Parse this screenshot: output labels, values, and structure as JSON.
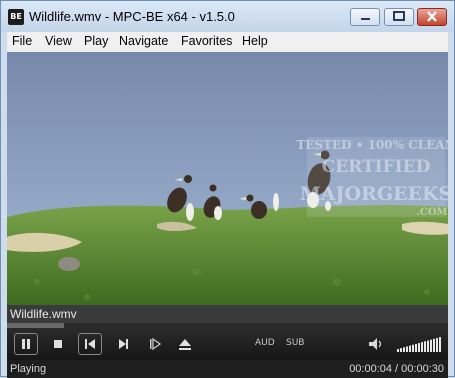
{
  "window": {
    "title": "Wildlife.wmv - MPC-BE x64 - v1.5.0",
    "app_icon_text": "BE"
  },
  "menu": {
    "items": [
      "File",
      "View",
      "Play",
      "Navigate",
      "Favorites",
      "Help"
    ]
  },
  "video": {
    "scene": "birds-on-grassy-dune",
    "watermark_lines": [
      "TESTED • 100% CLEAN",
      "CERTIFIED",
      "MAJORGEEKS",
      ".COM"
    ]
  },
  "player": {
    "filename": "Wildlife.wmv",
    "seek_progress": 0.13,
    "controls": {
      "aud_label": "AUD",
      "sub_label": "SUB"
    },
    "volume_level": 1.0,
    "status": "Playing",
    "time": "00:00:04 / 00:00:30"
  },
  "icons": {
    "pause": "pause-icon",
    "stop": "stop-icon",
    "prev": "skip-previous-icon",
    "next": "skip-next-icon",
    "frame_step": "frame-step-icon",
    "eject": "eject-icon",
    "volume": "speaker-icon"
  },
  "colors": {
    "titlebar": "#c9d9ec",
    "controls_bg": "#1e1e1e",
    "close_button": "#c4432e"
  }
}
